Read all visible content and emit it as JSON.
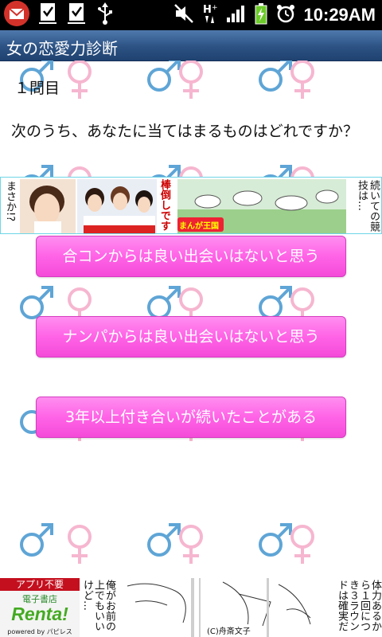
{
  "status_bar": {
    "time": "10:29AM",
    "icons": [
      "gmail-icon",
      "task-check-icon",
      "task-check-icon",
      "usb-icon",
      "mute-icon",
      "data-hplus-icon",
      "signal-icon",
      "battery-charging-icon",
      "alarm-icon"
    ]
  },
  "app": {
    "title": "女の恋愛力診断"
  },
  "question": {
    "number": "１問目",
    "text": "次のうち、あなたに当てはまるものはどれですか？"
  },
  "answers": [
    {
      "label": "合コンからは良い出会いはないと思う"
    },
    {
      "label": "ナンパからは良い出会いはないと思う"
    },
    {
      "label": "3年以上付き合いが続いたことがある"
    }
  ],
  "ads": {
    "top": {
      "left_text": "まさか!?",
      "mid_text": "棒倒しです",
      "logo_text": "まんが王国",
      "right_text": "続いての競技は…"
    },
    "bottom": {
      "renta_top": "アプリ不要",
      "renta_mid": "電子書店",
      "renta_logo": "Renta!",
      "renta_sub": "powered by パピレス",
      "bubble1": "俺がお前の上でもいいけど…",
      "credit": "(C)舟斎文子",
      "bubble2": "体力あるから１回につき３ラウンドは確実だ"
    }
  },
  "colors": {
    "button_pink": "#ff63e6",
    "title_bar": "#2c5283",
    "male_symbol": "#5fa5d6",
    "female_symbol": "#f6b6cf"
  }
}
